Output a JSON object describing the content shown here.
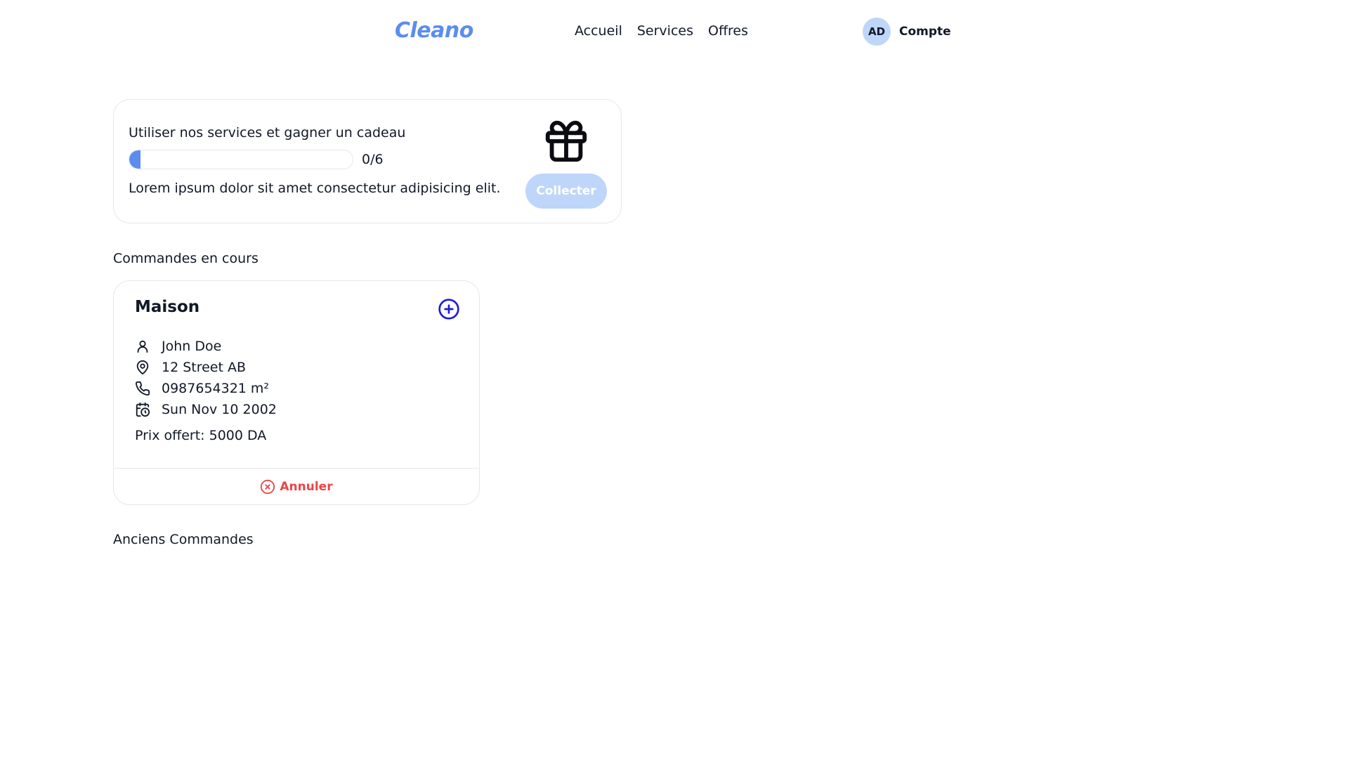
{
  "header": {
    "logo": "Cleano",
    "nav": [
      "Accueil",
      "Services",
      "Offres"
    ],
    "account": {
      "initials": "AD",
      "label": "Compte"
    }
  },
  "reward": {
    "title": "Utiliser nos services et gagner un cadeau",
    "progress": {
      "current": 0,
      "total": 6,
      "label": "0/6"
    },
    "description": "Lorem ipsum dolor sit amet consectetur adipisicing elit.",
    "button_label": "Collecter",
    "icon": "gift-icon"
  },
  "sections": {
    "current_orders": "Commandes en cours",
    "past_orders": "Anciens Commandes"
  },
  "orders": [
    {
      "title": "Maison",
      "name": "John Doe",
      "address": "12 Street AB",
      "phone": "0987654321 m²",
      "date": "Sun Nov 10 2002",
      "price": "Prix offert: 5000 DA",
      "cancel_label": "Annuler"
    }
  ],
  "colors": {
    "brand": "#5b8def",
    "button_disabled": "#bfd6fb",
    "danger": "#ef4444",
    "plus_icon": "#1d1bd6"
  }
}
